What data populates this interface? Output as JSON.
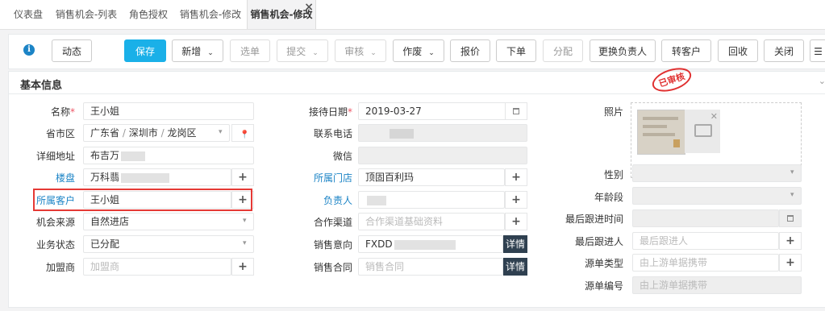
{
  "tabs": [
    {
      "label": "仪表盘"
    },
    {
      "label": "销售机会-列表"
    },
    {
      "label": "角色授权"
    },
    {
      "label": "销售机会-修改"
    },
    {
      "label": "销售机会-修改",
      "active": true,
      "close": "×"
    }
  ],
  "toolbar": {
    "info_icon": "info-circle-icon",
    "buttons": [
      {
        "label": "动态"
      },
      {
        "label": "保存"
      },
      {
        "label": "新增"
      },
      {
        "label": "选单"
      },
      {
        "label": "提交"
      },
      {
        "label": "审核"
      },
      {
        "label": "作废"
      },
      {
        "label": "报价"
      },
      {
        "label": "下单"
      },
      {
        "label": "分配"
      },
      {
        "label": "更换负责人"
      },
      {
        "label": "转客户"
      },
      {
        "label": "回收"
      },
      {
        "label": "关闭"
      }
    ],
    "caret": "⌄",
    "more_icon": "☰"
  },
  "section": {
    "title": "基本信息",
    "stamp": "已审核",
    "collapse_icon": "⌄"
  },
  "form": {
    "required_mark": "*",
    "name": {
      "label": "名称",
      "value": "王小姐"
    },
    "region": {
      "label": "省市区",
      "province": "广东省",
      "city": "深圳市",
      "district": "龙岗区",
      "sep": "/"
    },
    "address": {
      "label": "详细地址",
      "value": "布吉万"
    },
    "building": {
      "label": "楼盘",
      "value": "万科翡"
    },
    "customer": {
      "label": "所属客户",
      "value": "王小姐"
    },
    "source": {
      "label": "机会来源",
      "value": "自然进店"
    },
    "status": {
      "label": "业务状态",
      "value": "已分配"
    },
    "franchisee": {
      "label": "加盟商",
      "placeholder": "加盟商"
    },
    "reception_date": {
      "label": "接待日期",
      "value": "2019-03-27"
    },
    "phone": {
      "label": "联系电话",
      "value": ""
    },
    "wechat": {
      "label": "微信",
      "value": ""
    },
    "store": {
      "label": "所属门店",
      "value": "顶固百利玛"
    },
    "owner": {
      "label": "负责人",
      "value": ""
    },
    "channel": {
      "label": "合作渠道",
      "placeholder": "合作渠道基础资料"
    },
    "intent": {
      "label": "销售意向",
      "value": "FXDD",
      "detail": "详情"
    },
    "contract": {
      "label": "销售合同",
      "placeholder": "销售合同",
      "detail": "详情"
    },
    "photo": {
      "label": "照片"
    },
    "gender": {
      "label": "性别",
      "value": ""
    },
    "age": {
      "label": "年龄段",
      "value": ""
    },
    "last_follow_time": {
      "label": "最后跟进时间",
      "value": ""
    },
    "last_follower": {
      "label": "最后跟进人",
      "placeholder": "最后跟进人"
    },
    "source_type": {
      "label": "源单类型",
      "placeholder": "由上游单据携带"
    },
    "source_no": {
      "label": "源单编号",
      "placeholder": "由上游单据携带"
    },
    "plus": "+"
  }
}
